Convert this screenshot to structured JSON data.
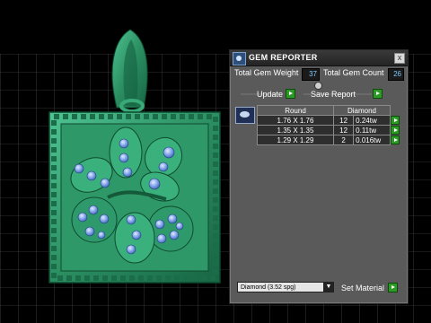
{
  "panel": {
    "title": "GEM REPORTER",
    "close_label": "x",
    "total_gem_weight_label": "Total Gem Weight",
    "total_gem_weight_value": "37",
    "total_gem_count_label": "Total Gem Count",
    "total_gem_count_value": "26",
    "update_label": "Update",
    "save_report_label": "Save Report",
    "table": {
      "headers": [
        "Round",
        "Diamond"
      ],
      "rows": [
        {
          "size": "1.76 X 1.76",
          "count": "12",
          "weight": "0.24tw"
        },
        {
          "size": "1.35 X 1.35",
          "count": "12",
          "weight": "0.11tw"
        },
        {
          "size": "1.29 X 1.29",
          "count": "2",
          "weight": "0.016tw"
        }
      ]
    },
    "material_selected": "Diamond    (3.52 spg)",
    "set_material_label": "Set Material"
  },
  "colors": {
    "metal": "#2e8f62",
    "gem": "#7ea4ea",
    "panel_bg": "#5a5a5a",
    "accent_button": "#2d9a28"
  }
}
